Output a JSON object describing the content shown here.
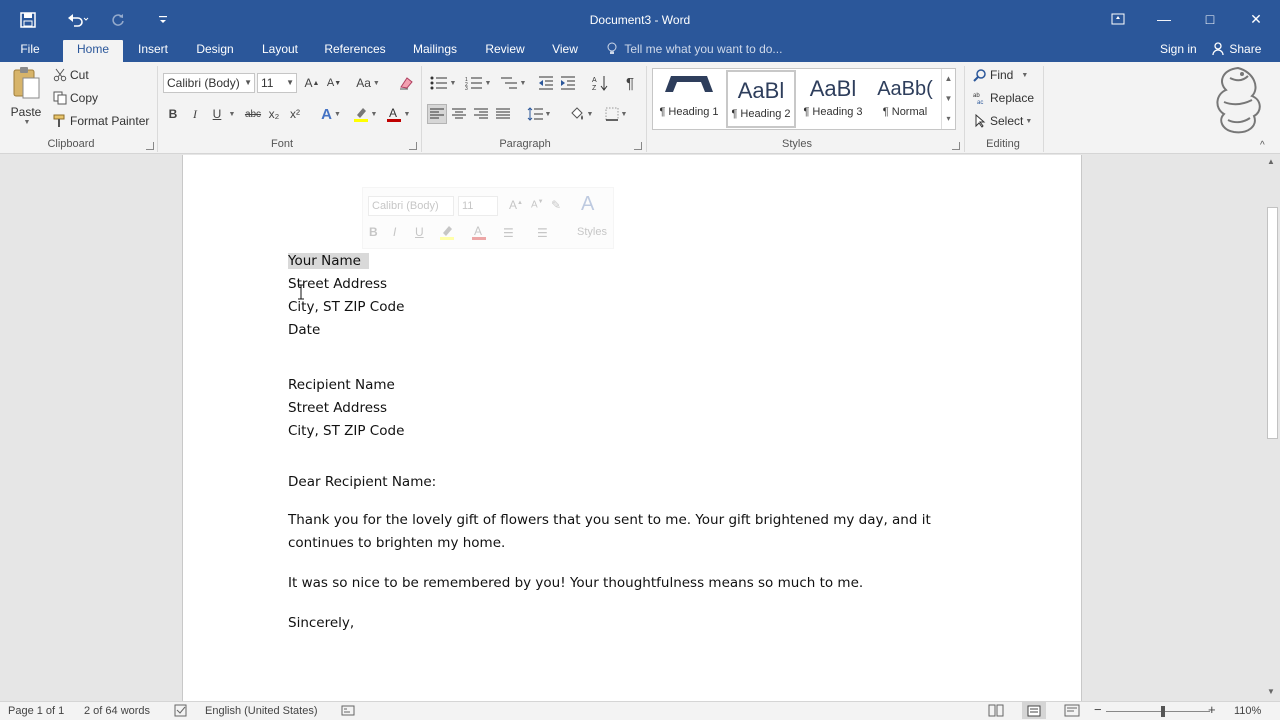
{
  "window": {
    "title": "Document3 - Word",
    "minimize": "—",
    "maximize": "□",
    "close": "✕"
  },
  "quick_access": {
    "save_icon": "save-icon",
    "undo_icon": "undo-icon",
    "redo_icon": "redo-icon",
    "customize_icon": "customize-icon"
  },
  "tabs": [
    {
      "label": "File"
    },
    {
      "label": "Home",
      "active": true
    },
    {
      "label": "Insert"
    },
    {
      "label": "Design"
    },
    {
      "label": "Layout"
    },
    {
      "label": "References"
    },
    {
      "label": "Mailings"
    },
    {
      "label": "Review"
    },
    {
      "label": "View"
    }
  ],
  "tell_me": "Tell me what you want to do...",
  "sign_in": "Sign in",
  "share": "Share",
  "clipboard": {
    "paste": "Paste",
    "cut": "Cut",
    "copy": "Copy",
    "format_painter": "Format Painter",
    "label": "Clipboard"
  },
  "font": {
    "name": "Calibri (Body)",
    "size": "11",
    "label": "Font",
    "bold": "B",
    "italic": "I",
    "underline": "U",
    "strike": "abc",
    "subscript": "x₂",
    "superscript": "x²",
    "font_color_accent": "#c00000",
    "highlight_accent": "#ffff00"
  },
  "paragraph": {
    "label": "Paragraph",
    "pilcrow": "¶"
  },
  "styles": {
    "label": "Styles",
    "items": [
      {
        "sample": "",
        "name": "¶ Heading 1"
      },
      {
        "sample": "AaBl",
        "name": "¶ Heading 2",
        "selected": true
      },
      {
        "sample": "AaBl",
        "name": "¶ Heading 3"
      },
      {
        "sample": "AaBb(",
        "name": "¶ Normal"
      }
    ]
  },
  "editing": {
    "label": "Editing",
    "find": "Find",
    "replace": "Replace",
    "select": "Select"
  },
  "mini_toolbar": {
    "font": "Calibri (Body)",
    "size": "11",
    "styles": "Styles"
  },
  "document": {
    "lines_sender": [
      "Your Name",
      "Street Address",
      "City, ST ZIP Code",
      "Date"
    ],
    "lines_recipient": [
      "Recipient Name",
      "Street Address",
      "City, ST ZIP Code"
    ],
    "salutation": "Dear Recipient Name:",
    "paragraph1_line1": "Thank you for the lovely gift of flowers that you sent to me. Your gift brightened my day, and it",
    "paragraph1_line2": "continues to brighten my home.",
    "paragraph2": "It was so nice to be remembered by you! Your thoughtfulness means so much to me.",
    "closing": "Sincerely,"
  },
  "status": {
    "page": "Page 1 of 1",
    "words": "2 of 64 words",
    "language": "English (United States)",
    "zoom_minus": "−",
    "zoom_plus": "+",
    "zoom": "110%",
    "zoom_level_fraction": 0.55
  }
}
